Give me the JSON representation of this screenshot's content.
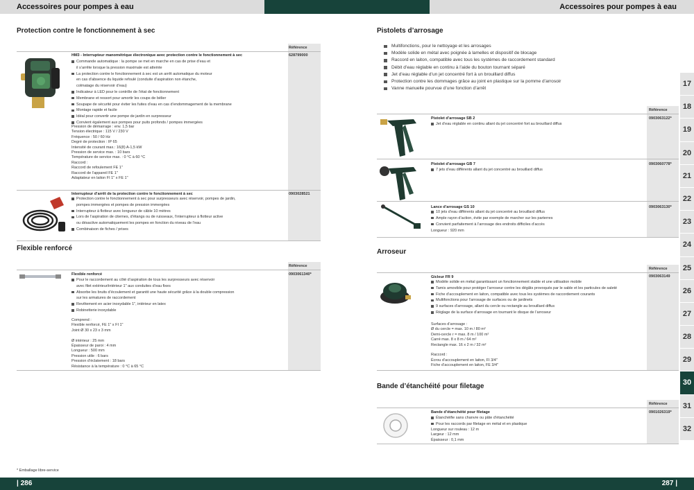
{
  "header": {
    "left_title": "Accessoires pour pompes à eau",
    "right_title": "Accessoires pour pompes à eau"
  },
  "footer": {
    "left_page": "| 286",
    "right_page": "287 |",
    "footnote": "* Emballage libre-service"
  },
  "colors": {
    "brand_dark_green": "#17433a",
    "tab_gray": "#e4e4e4",
    "ref_column": "#e6e6e6"
  },
  "ref_label": "Référence",
  "tabs": [
    "17",
    "18",
    "19",
    "20",
    "21",
    "22",
    "23",
    "24",
    "25",
    "26",
    "27",
    "28",
    "29",
    "30",
    "31",
    "32"
  ],
  "active_tab": "30",
  "protection": {
    "title": "Protection contre le fonctionnement à sec",
    "p1": {
      "title": "HM3 - Interrupteur manométrique électronique avec protection contre le fonctionnement à sec",
      "ref": "628799000",
      "bullets": [
        "Commande automatique : la pompe se met en marche en cas de prise d’eau et\nil s’arrête lorsque la pression maximale est atteinte",
        "La protection contre le fonctionnement à sec est un arrêt automatique du moteur\nen cas d’absence du liquide refoulé (conduite d’aspiration non étanche,\ncolmatage du réservoir d’eau)",
        "Indicateur à LED pour le contrôle de l’état de fonctionnement",
        "Membrane et ressort pour amortir les coups de bélier",
        "Soupape de sécurité pour éviter les fuites d’eau en cas d’endommagement de la membrane",
        "Montage rapide et facile",
        "Idéal pour convertir une pompe de jardin en surpresseur",
        "Convient également aux pompes pour puits profonds / pompes immergées"
      ],
      "specs": "Pression de démarrage : env. 1,5 bar\nTension électrique : 115 V / 230 V\nFréquence : 50 / 60 Hz\nDegré de protection : IP 65\nIntensité de courant max.: 16(8) A-1,5 kW\nPression de service max. : 10 bars\nTempérature de service max. : 0 °C à 60 °C\nRaccord :\nRaccord de refoulement FE 1\"\nRaccord de l’appareil FE 1\"\nAdaptateur en laiton FI 1\" x FE 1\""
    },
    "p2": {
      "title": "Interrupteur d’arrêt de la protection contre le fonctionnement à sec",
      "ref": "0903028521",
      "bullets": [
        "Protection contre le fonctionnement à sec pour surpresseurs avec réservoir, pompes de jardin,\npompes immergées et pompes de pression immergées",
        "Interrupteur à flotteur avec longueur de câble 10 mètres",
        "Lors de l’aspiration de citernes, d’étangs ou de ruisseaux, l’interrupteur à flotteur active\nou désactive automatiquement les pompes en fonction du niveau de l’eau",
        "Combinaison de fiches / prises"
      ]
    }
  },
  "flexible": {
    "title": "Flexible renforcé",
    "title_item": "Flexible renforcé",
    "ref": "0903061340*",
    "bullets": [
      "Pour le raccordement au côté d’aspiration de tous les surpresseurs avec réservoir\navec filet extérieur/intérieur 1\" aux conduites d’eau fixes",
      "Absorbe les bruits d’écoulement et garantit une haute sécurité grâce à la double compression\nsur les armatures de raccordement",
      "Revêtement en acier inoxydable 1\", intérieur en latex",
      "Robinetterie inoxydable"
    ],
    "specs": "Comprend :\nFlexible renforcé, FE 1\" x FI 1\"\nJoint Ø 30 x 23 x 3 mm\n\nØ intérieur : 25 mm\nÉpaisseur de paroi : 4 mm\nLongueur : 500 mm\nPression utile : 6 bars\nPression d’éclatement : 18 bars\nRésistance à la température : 0 °C à 65 °C"
  },
  "pistolets": {
    "title": "Pistolets d’arrosage",
    "bullets": [
      "Multifonctions, pour le nettoyage et les arrosages",
      "Modèle solide en métal avec poignée à lamelles et dispositif de blocage",
      "Raccord en laiton, compatible avec tous les systèmes de raccordement standard",
      "Débit d’eau réglable en continu à l’aide du bouton tournant séparé",
      "Jet d’eau réglable d’un jet concentré fort à un brouillard diffus",
      "Protection contre les dommages grâce au joint en plastique sur la pomme d’arrosoir",
      "Vanne manuelle pourvue d’une fonction d’arrêt"
    ],
    "sb2": {
      "title": "Pistolet d’arrosage SB 2",
      "ref": "0903063122*",
      "bullets": [
        "Jet d’eau réglable en continu allant du jet concentré fort au brouillard diffus"
      ]
    },
    "gb7": {
      "title": "Pistolet d’arrosage GB 7",
      "ref": "0903060778*",
      "bullets": [
        "7 jets d’eau différents allant du jet concentré au brouillard diffus"
      ]
    },
    "gs10": {
      "title": "Lance d’arrosage GS 10",
      "ref": "0903063130*",
      "bullets": [
        "10 jets d’eau différents allant du jet concentré au brouillard diffus",
        "Ample rayon d’action, évite par exemple de marcher sur les parterres",
        "Convient parfaitement à l’arrosage des endroits difficiles d’accès"
      ],
      "specs": "Longueur : 920 mm"
    }
  },
  "arroseur": {
    "title": "Arroseur",
    "item_title": "Gicleur FR 9",
    "ref": "0903063149",
    "bullets": [
      "Modèle solide en métal garantissant un fonctionnement stable et une utilisation mobile",
      "Tamis amovible pour protéger l’arroseur contre les dégâts provoqués par le sable et les particules de saleté",
      "Fiche d’accouplement en laiton, compatible avec tous les systèmes de raccordement courants",
      "Multifonctions pour l’arrosage de surfaces ou de jardinets",
      "9 surfaces d’arrosage, allant du cercle ou rectangle au brouillard diffus",
      "Réglage de la surface d’arrosage en tournant le disque de l’arroseur"
    ],
    "specs": "Surfaces d’arrosage :\nØ du cercle = max. 10 m / 80 m²\nDemi-cercle r = max. 8 m / 100 m²\nCarré max. 8 x 8 m / 64 m²\nRectangle max. 16 x 2 m / 32 m²\n\nRaccord :\nÉcrou d’accouplement en laiton, FI 3/4\"\nFiche d’accouplement en laiton, FE 3/4\""
  },
  "bande": {
    "title": "Bande d’étanchéité pour filetage",
    "item_title": "Bande d’étanchéité pour filetage",
    "ref": "0901026319*",
    "bullets": [
      "Étanchéifie sans chanvre ou pâte d’étanchéité",
      "Pour les raccords par filetage en métal et en plastique"
    ],
    "specs": "Longueur sur rouleau : 12 m\nLargeur : 12 mm\nÉpaisseur : 0,1 mm"
  }
}
